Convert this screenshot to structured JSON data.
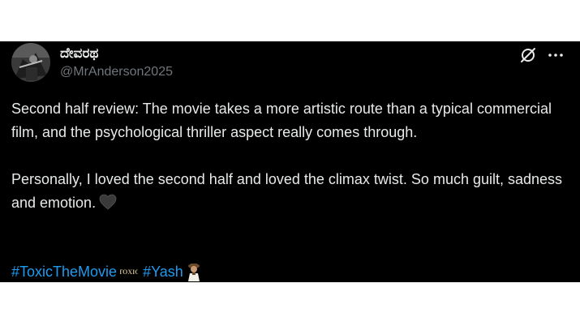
{
  "tweet": {
    "author": {
      "display_name": "ದೇವರಥ",
      "handle": "@MrAnderson2025",
      "avatar_icon": "avatar-photo"
    },
    "actions": {
      "grok_icon": "grok-icon",
      "more_icon": "more-horizontal-icon"
    },
    "paragraphs": [
      "Second half review: The movie takes a more artistic route than a typical commercial film, and the psychological thriller aspect really comes through.",
      "Personally, I loved the second half and loved the climax twist. So much guilt, sadness and emotion."
    ],
    "emoji": "black-heart-icon",
    "hashtags": [
      {
        "label": "#ToxicTheMovie",
        "emoji_icon": "toxic-logo-icon",
        "emoji_text": "TOXIC"
      },
      {
        "label": "#Yash",
        "emoji_icon": "yash-figure-icon"
      }
    ],
    "colors": {
      "background": "#000000",
      "text": "#e7e9ea",
      "handle": "#71767b",
      "hashtag": "#1d9bf0"
    }
  }
}
